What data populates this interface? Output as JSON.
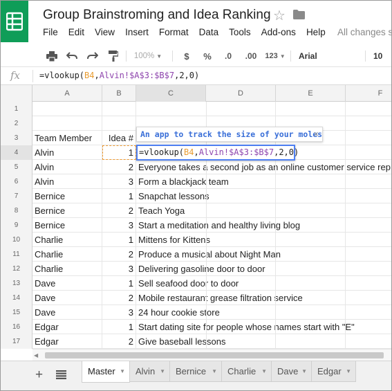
{
  "app": {
    "title": "Group Brainstroming and Idea Ranking",
    "save_status": "All changes s",
    "brand_color": "#0f9d58"
  },
  "menu": [
    "File",
    "Edit",
    "View",
    "Insert",
    "Format",
    "Data",
    "Tools",
    "Add-ons",
    "Help"
  ],
  "toolbar": {
    "zoom": "100%",
    "currency": "$",
    "percent": "%",
    "dec_decrease": ".0",
    "dec_increase": ".00",
    "more_formats": "123",
    "font": "Arial",
    "font_size": "10",
    "icons": [
      "print-icon",
      "undo-icon",
      "redo-icon",
      "paint-format-icon"
    ]
  },
  "formula_bar": {
    "fx": "fx",
    "prefix": "=vlookup(",
    "ref": "B4",
    "sep1": ",",
    "range": "Alvin!$A$3:$B$7",
    "suffix": ",2,0)"
  },
  "columns": [
    "A",
    "B",
    "C",
    "D",
    "E",
    "F"
  ],
  "rows": [
    {
      "n": "1",
      "a": "",
      "b": "",
      "c": ""
    },
    {
      "n": "2",
      "a": "",
      "b": "",
      "c": ""
    },
    {
      "n": "3",
      "a": "Team Member",
      "b": "Idea #",
      "c": ""
    },
    {
      "n": "4",
      "a": "Alvin",
      "b": "1",
      "c": ""
    },
    {
      "n": "5",
      "a": "Alvin",
      "b": "2",
      "c": "Everyone takes a second job as an online customer service rep"
    },
    {
      "n": "6",
      "a": "Alvin",
      "b": "3",
      "c": "Form a blackjack team"
    },
    {
      "n": "7",
      "a": "Bernice",
      "b": "1",
      "c": "Snapchat lessons"
    },
    {
      "n": "8",
      "a": "Bernice",
      "b": "2",
      "c": "Teach Yoga"
    },
    {
      "n": "9",
      "a": "Bernice",
      "b": "3",
      "c": "Start a meditation and healthy living blog"
    },
    {
      "n": "10",
      "a": "Charlie",
      "b": "1",
      "c": "Mittens for Kittens"
    },
    {
      "n": "11",
      "a": "Charlie",
      "b": "2",
      "c": "Produce a musical about Night Man"
    },
    {
      "n": "12",
      "a": "Charlie",
      "b": "3",
      "c": "Delivering gasoline door to door"
    },
    {
      "n": "13",
      "a": "Dave",
      "b": "1",
      "c": "Sell seafood door to door"
    },
    {
      "n": "14",
      "a": "Dave",
      "b": "2",
      "c": "Mobile restaurant grease filtration service"
    },
    {
      "n": "15",
      "a": "Dave",
      "b": "3",
      "c": "24 hour cookie store"
    },
    {
      "n": "16",
      "a": "Edgar",
      "b": "1",
      "c": "Start dating site for people whose names start with \"E\""
    },
    {
      "n": "17",
      "a": "Edgar",
      "b": "2",
      "c": "Give baseball lessons"
    }
  ],
  "tooltip": {
    "text": "An app to track the size of your moles",
    "close": "×"
  },
  "sheets": [
    "Master",
    "Alvin",
    "Bernice",
    "Charlie",
    "Dave",
    "Edgar"
  ],
  "active_sheet": "Master"
}
